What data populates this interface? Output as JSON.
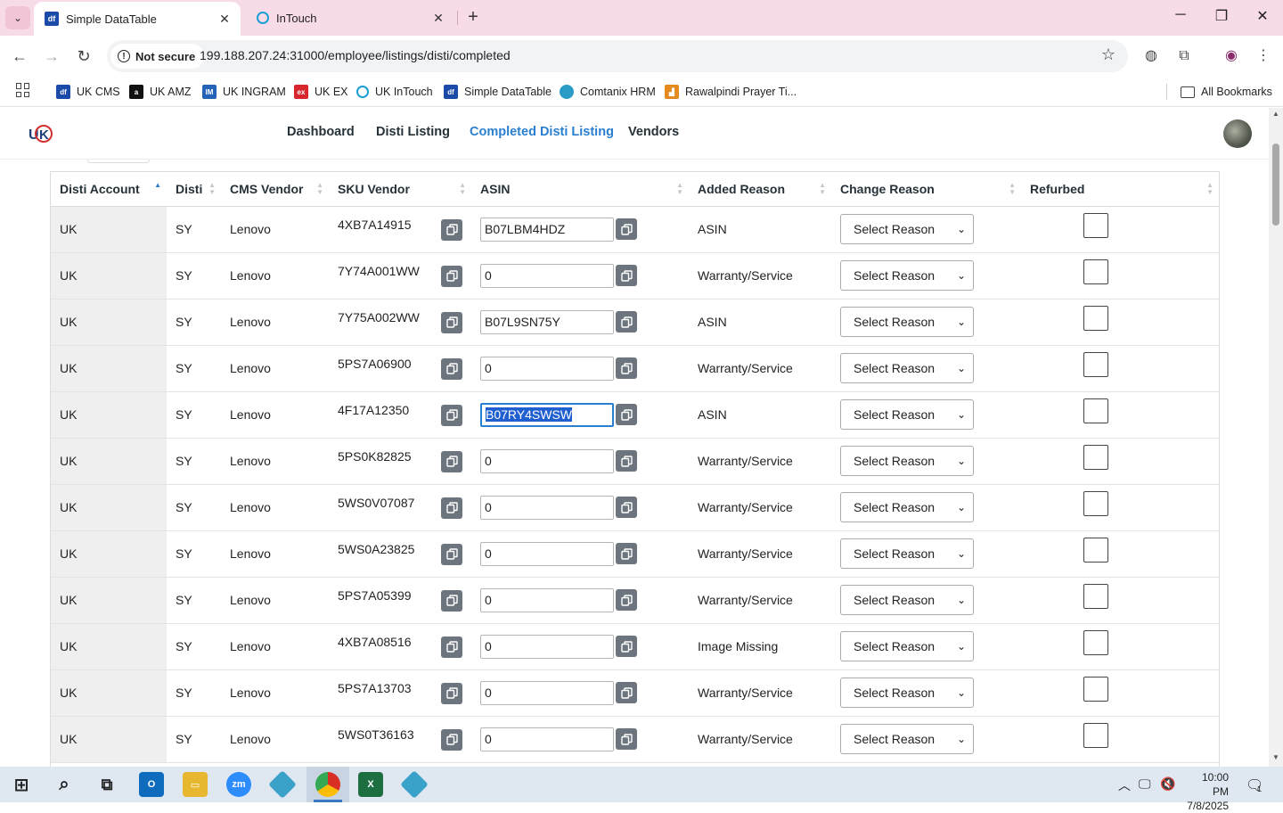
{
  "browser": {
    "tabs": [
      {
        "title": "Simple DataTable",
        "active": true
      },
      {
        "title": "InTouch",
        "active": false
      }
    ],
    "security_label": "Not secure",
    "url": "199.188.207.24:31000/employee/listings/disti/completed",
    "bookmarks": [
      "UK CMS",
      "UK AMZ",
      "UK INGRAM",
      "UK EX",
      "UK InTouch",
      "Simple DataTable",
      "Comtanix HRM",
      "Rawalpindi Prayer Ti..."
    ],
    "all_bookmarks": "All Bookmarks"
  },
  "app": {
    "nav": [
      "Dashboard",
      "Disti Listing",
      "Completed Disti Listing",
      "Vendors"
    ],
    "active_nav": "Completed Disti Listing"
  },
  "table": {
    "columns": [
      "Disti Account",
      "Disti",
      "CMS Vendor",
      "SKU Vendor",
      "ASIN",
      "Added Reason",
      "Change Reason",
      "Refurbed"
    ],
    "rows": [
      {
        "account": "UK",
        "disti": "SY",
        "vendor": "Lenovo",
        "sku": "4XB7A14915",
        "asin": "B07LBM4HDZ",
        "reason": "ASIN",
        "change": "Select Reason"
      },
      {
        "account": "UK",
        "disti": "SY",
        "vendor": "Lenovo",
        "sku": "7Y74A001WW",
        "asin": "0",
        "reason": "Warranty/Service",
        "change": "Select Reason"
      },
      {
        "account": "UK",
        "disti": "SY",
        "vendor": "Lenovo",
        "sku": "7Y75A002WW",
        "asin": "B07L9SN75Y",
        "reason": "ASIN",
        "change": "Select Reason"
      },
      {
        "account": "UK",
        "disti": "SY",
        "vendor": "Lenovo",
        "sku": "5PS7A06900",
        "asin": "0",
        "reason": "Warranty/Service",
        "change": "Select Reason"
      },
      {
        "account": "UK",
        "disti": "SY",
        "vendor": "Lenovo",
        "sku": "4F17A12350",
        "asin": "B07RY4SWSW",
        "reason": "ASIN",
        "change": "Select Reason"
      },
      {
        "account": "UK",
        "disti": "SY",
        "vendor": "Lenovo",
        "sku": "5PS0K82825",
        "asin": "0",
        "reason": "Warranty/Service",
        "change": "Select Reason"
      },
      {
        "account": "UK",
        "disti": "SY",
        "vendor": "Lenovo",
        "sku": "5WS0V07087",
        "asin": "0",
        "reason": "Warranty/Service",
        "change": "Select Reason"
      },
      {
        "account": "UK",
        "disti": "SY",
        "vendor": "Lenovo",
        "sku": "5WS0A23825",
        "asin": "0",
        "reason": "Warranty/Service",
        "change": "Select Reason"
      },
      {
        "account": "UK",
        "disti": "SY",
        "vendor": "Lenovo",
        "sku": "5PS7A05399",
        "asin": "0",
        "reason": "Warranty/Service",
        "change": "Select Reason"
      },
      {
        "account": "UK",
        "disti": "SY",
        "vendor": "Lenovo",
        "sku": "4XB7A08516",
        "asin": "0",
        "reason": "Image Missing",
        "change": "Select Reason"
      },
      {
        "account": "UK",
        "disti": "SY",
        "vendor": "Lenovo",
        "sku": "5PS7A13703",
        "asin": "0",
        "reason": "Warranty/Service",
        "change": "Select Reason"
      },
      {
        "account": "UK",
        "disti": "SY",
        "vendor": "Lenovo",
        "sku": "5WS0T36163",
        "asin": "0",
        "reason": "Warranty/Service",
        "change": "Select Reason"
      }
    ],
    "focused_row": 4,
    "sorted_column": "Disti Account"
  },
  "taskbar": {
    "time": "10:00 PM",
    "date": "7/8/2025",
    "notification_count": "1"
  },
  "colors": {
    "tabstrip": "#f8dbe8",
    "accent": "#2a7fcf",
    "copy_button": "#6c757d"
  }
}
